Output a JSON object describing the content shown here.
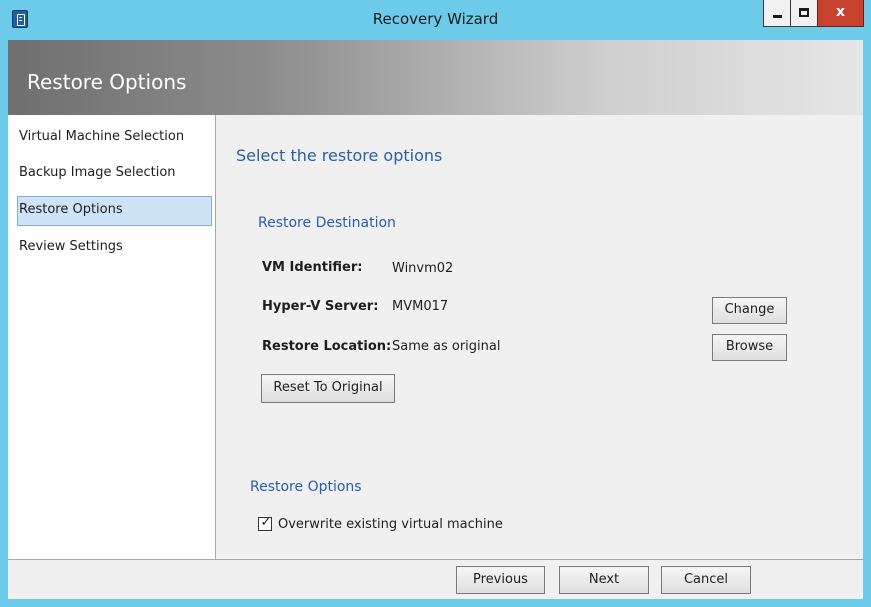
{
  "window": {
    "title": "Recovery Wizard",
    "close_glyph": "x",
    "icons": [
      "app-icon",
      "minimize-icon",
      "maximize-icon",
      "close-icon"
    ]
  },
  "header": {
    "page_heading": "Restore Options"
  },
  "nav": {
    "items": [
      {
        "label": "Virtual Machine Selection",
        "selected": false
      },
      {
        "label": "Backup Image Selection",
        "selected": false
      },
      {
        "label": "Restore Options",
        "selected": true
      },
      {
        "label": "Review Settings",
        "selected": false
      }
    ]
  },
  "content": {
    "heading": "Select the restore options",
    "destination": {
      "heading": "Restore Destination",
      "vm_identifier_label": "VM Identifier:",
      "vm_identifier_value": "Winvm02",
      "hyperv_label": "Hyper-V Server:",
      "hyperv_value": "MVM017",
      "location_label": "Restore Location:",
      "location_value": "Same as original",
      "change_label": "Change",
      "browse_label": "Browse",
      "reset_label": "Reset To Original"
    },
    "options": {
      "heading": "Restore Options",
      "overwrite_label": "Overwrite existing virtual machine",
      "overwrite_checked": true,
      "checkmark": "✓"
    }
  },
  "footer": {
    "previous_label": "Previous",
    "next_label": "Next",
    "cancel_label": "Cancel"
  },
  "colors": {
    "titlebar": "#6bcbe8",
    "accent_text": "#2a5ea8",
    "selected_nav": "#cfe3f7",
    "close_button": "#c7412f"
  }
}
